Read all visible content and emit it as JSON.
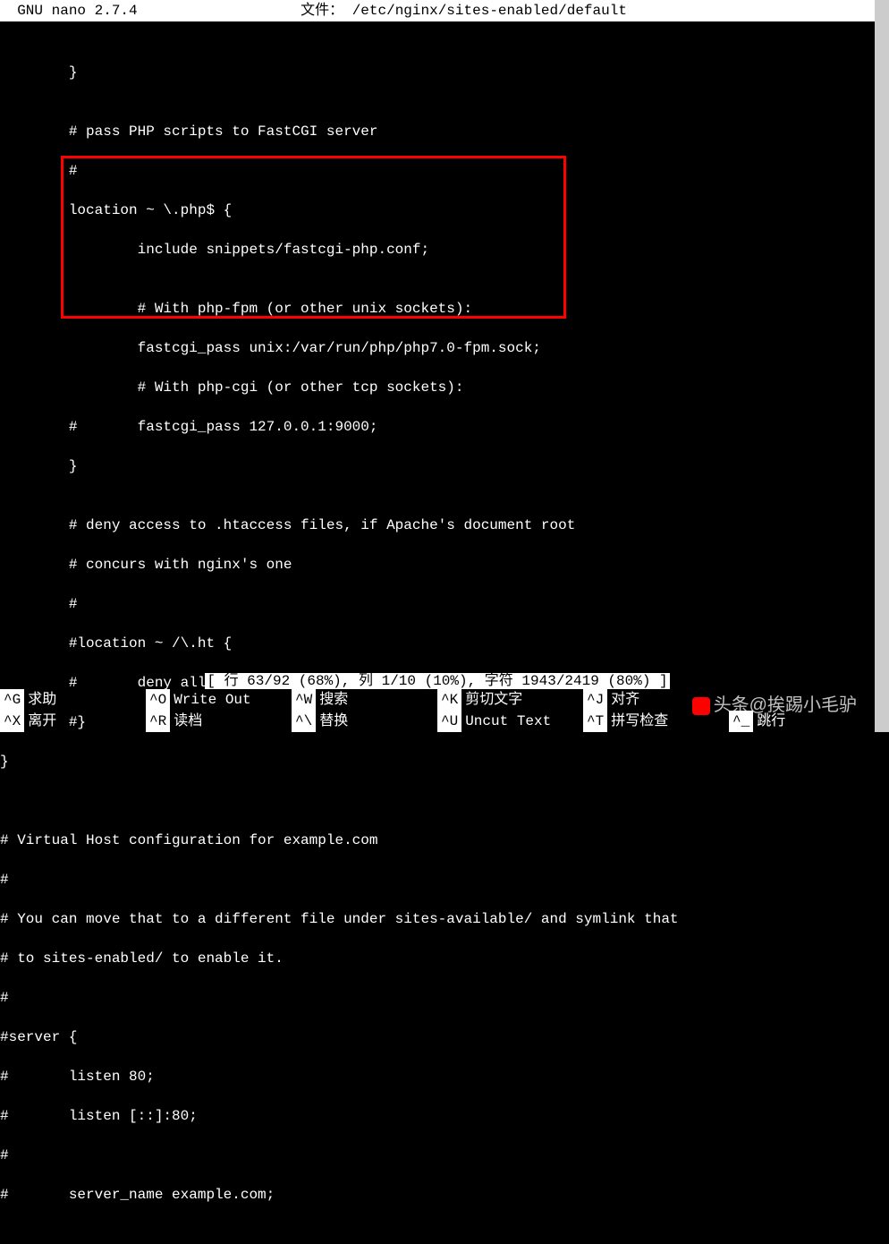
{
  "titlebar": {
    "app": "GNU nano 2.7.4",
    "file_label": "文件：",
    "file_path": "/etc/nginx/sites-enabled/default"
  },
  "lines": [
    "",
    "        }",
    "",
    "        # pass PHP scripts to FastCGI server",
    "        #",
    "        location ~ \\.php$ {",
    "                include snippets/fastcgi-php.conf;",
    "",
    "                # With php-fpm (or other unix sockets):",
    "                fastcgi_pass unix:/var/run/php/php7.0-fpm.sock;",
    "                # With php-cgi (or other tcp sockets):",
    "        #       fastcgi_pass 127.0.0.1:9000;",
    "        }",
    "",
    "        # deny access to .htaccess files, if Apache's document root",
    "        # concurs with nginx's one",
    "        #",
    "        #location ~ /\\.ht {",
    "        #       deny all;",
    "        #}",
    "}",
    "",
    "",
    "# Virtual Host configuration for example.com",
    "#",
    "# You can move that to a different file under sites-available/ and symlink that",
    "# to sites-enabled/ to enable it.",
    "#",
    "#server {",
    "#       listen 80;",
    "#       listen [::]:80;",
    "#",
    "#       server_name example.com;"
  ],
  "status": {
    "text": "[ 行 63/92 (68%), 列 1/10 (10%), 字符 1943/2419 (80%) ]"
  },
  "help": {
    "row1": [
      {
        "key": "^G",
        "label": "求助"
      },
      {
        "key": "^O",
        "label": "Write Out"
      },
      {
        "key": "^W",
        "label": "搜索"
      },
      {
        "key": "^K",
        "label": "剪切文字"
      },
      {
        "key": "^J",
        "label": "对齐"
      },
      {
        "key": "",
        "label": ""
      }
    ],
    "row2": [
      {
        "key": "^X",
        "label": "离开"
      },
      {
        "key": "^R",
        "label": "读档"
      },
      {
        "key": "^\\",
        "label": "替换"
      },
      {
        "key": "^U",
        "label": "Uncut Text"
      },
      {
        "key": "^T",
        "label": "拼写检查"
      },
      {
        "key": "^_",
        "label": "跳行"
      }
    ]
  },
  "watermark": "头条@挨踢小毛驴"
}
